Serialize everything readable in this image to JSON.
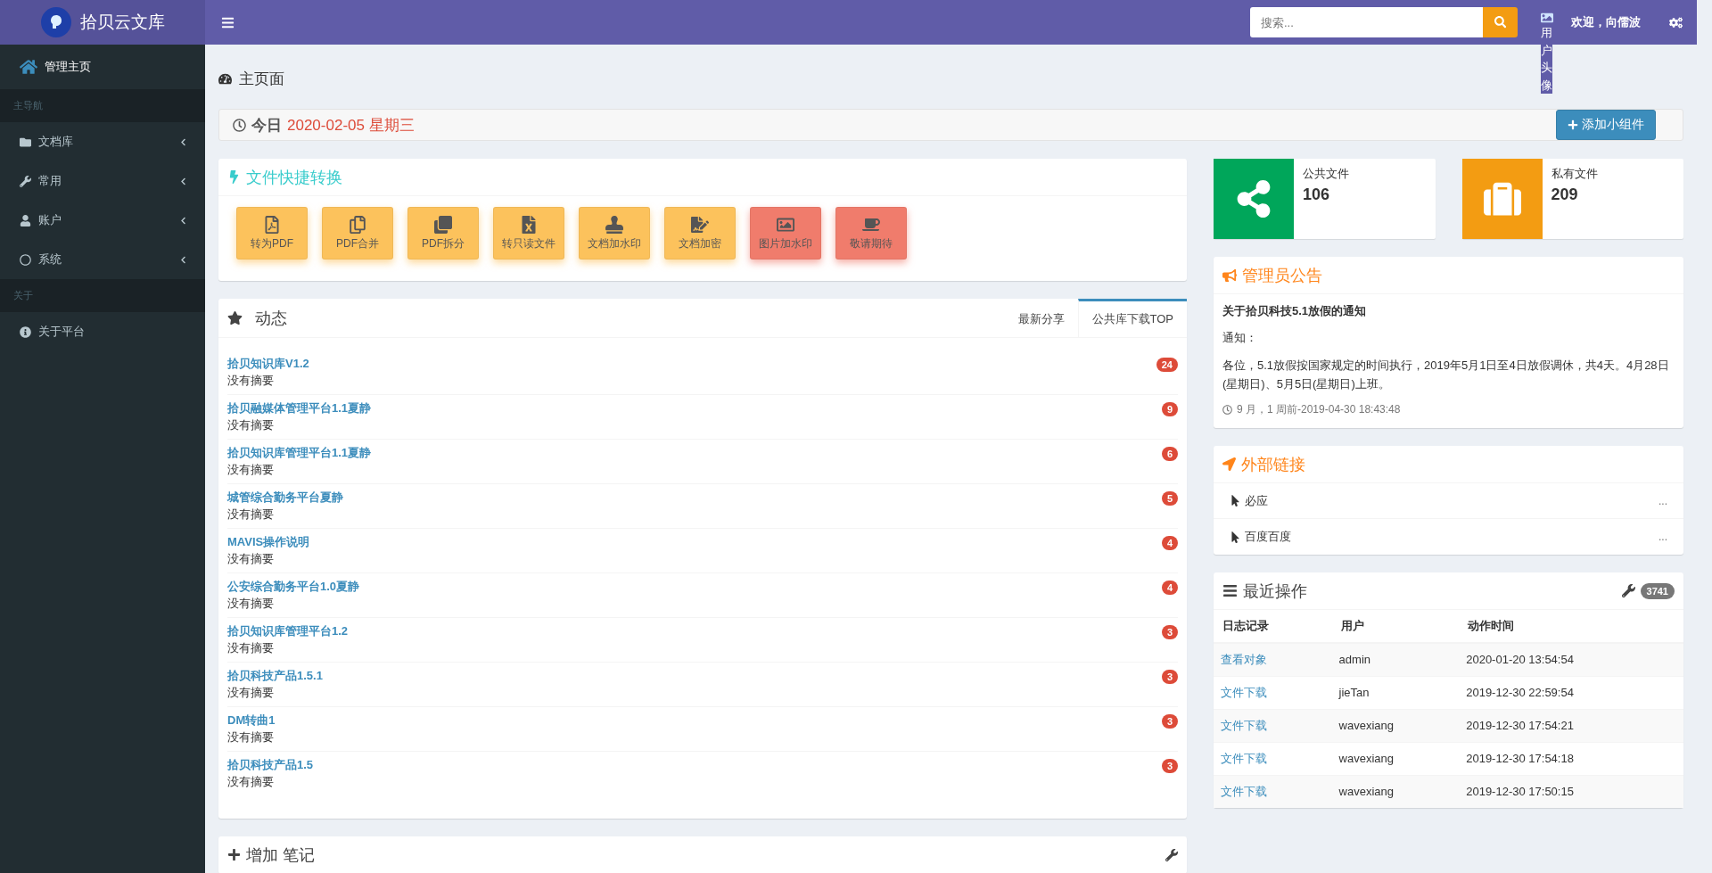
{
  "brand": {
    "name": "拾贝云文库"
  },
  "header": {
    "search": {
      "placeholder": "搜索..."
    },
    "avatar_alt": "用户头像",
    "welcome": "欢迎，向儒波"
  },
  "sidebar": {
    "items": [
      {
        "kind": "link",
        "label": "管理主页",
        "selected": true
      },
      {
        "kind": "header",
        "label": "主导航"
      },
      {
        "kind": "menu",
        "label": "文档库",
        "expanded": false
      },
      {
        "kind": "menu",
        "label": "常用",
        "expanded": false
      },
      {
        "kind": "menu",
        "label": "账户",
        "expanded": false
      },
      {
        "kind": "menu",
        "label": "系统",
        "expanded": false
      },
      {
        "kind": "header",
        "label": "关于"
      },
      {
        "kind": "link",
        "label": "关于平台",
        "selected": false
      }
    ]
  },
  "page_title": "主页面",
  "today": {
    "label": "今日",
    "date": "2020-02-05 星期三",
    "button": "添加小组件"
  },
  "quick_convert": {
    "title": "文件快捷转换",
    "buttons": [
      {
        "label": "转为PDF",
        "color": "#fcc25c"
      },
      {
        "label": "PDF合并",
        "color": "#fcc25c"
      },
      {
        "label": "PDF拆分",
        "color": "#fcc25c"
      },
      {
        "label": "转只读文件",
        "color": "#fcc25c"
      },
      {
        "label": "文档加水印",
        "color": "#fcc25c"
      },
      {
        "label": "文档加密",
        "color": "#fcc25c"
      },
      {
        "label": "图片加水印",
        "color": "#f07c6c"
      },
      {
        "label": "敬请期待",
        "color": "#f07c6c"
      }
    ]
  },
  "feed": {
    "title": "动态",
    "tabs": [
      {
        "label": "最新分享",
        "selected": false
      },
      {
        "label": "公共库下载TOP",
        "selected": true
      }
    ],
    "items": [
      {
        "title": "拾贝知识库V1.2",
        "summary": "没有摘要",
        "count": "24"
      },
      {
        "title": "拾贝融媒体管理平台1.1夏静",
        "summary": "没有摘要",
        "count": "9"
      },
      {
        "title": "拾贝知识库管理平台1.1夏静",
        "summary": "没有摘要",
        "count": "6"
      },
      {
        "title": "城管综合勤务平台夏静",
        "summary": "没有摘要",
        "count": "5"
      },
      {
        "title": "MAVIS操作说明",
        "summary": "没有摘要",
        "count": "4"
      },
      {
        "title": "公安综合勤务平台1.0夏静",
        "summary": "没有摘要",
        "count": "4"
      },
      {
        "title": "拾贝知识库管理平台1.2",
        "summary": "没有摘要",
        "count": "3"
      },
      {
        "title": "拾贝科技产品1.5.1",
        "summary": "没有摘要",
        "count": "3"
      },
      {
        "title": "DM转曲1",
        "summary": "没有摘要",
        "count": "3"
      },
      {
        "title": "拾贝科技产品1.5",
        "summary": "没有摘要",
        "count": "3"
      }
    ]
  },
  "notes": {
    "title": "增加 笔记"
  },
  "stats": [
    {
      "label": "公共文件",
      "value": "106",
      "color": "#00a65a"
    },
    {
      "label": "私有文件",
      "value": "209",
      "color": "#f39c12"
    }
  ],
  "announcement": {
    "title": "管理员公告",
    "heading": "关于拾贝科技5.1放假的通知",
    "lines": [
      "通知：",
      "各位，5.1放假按国家规定的时间执行，2019年5月1日至4日放假调休，共4天。4月28日(星期日)、5月5日(星期日)上班。"
    ],
    "meta": "9 月，1 周前-2019-04-30 18:43:48"
  },
  "links": {
    "title": "外部链接",
    "items": [
      {
        "label": "必应",
        "more": "..."
      },
      {
        "label": "百度百度",
        "more": "..."
      }
    ]
  },
  "recent": {
    "title": "最近操作",
    "count": "3741",
    "columns": [
      "日志记录",
      "用户",
      "动作时间"
    ],
    "rows": [
      [
        "查看对象",
        "admin",
        "2020-01-20 13:54:54"
      ],
      [
        "文件下载",
        "jieTan",
        "2019-12-30 22:59:54"
      ],
      [
        "文件下载",
        "wavexiang",
        "2019-12-30 17:54:21"
      ],
      [
        "文件下载",
        "wavexiang",
        "2019-12-30 17:54:18"
      ],
      [
        "文件下载",
        "wavexiang",
        "2019-12-30 17:50:15"
      ]
    ]
  }
}
